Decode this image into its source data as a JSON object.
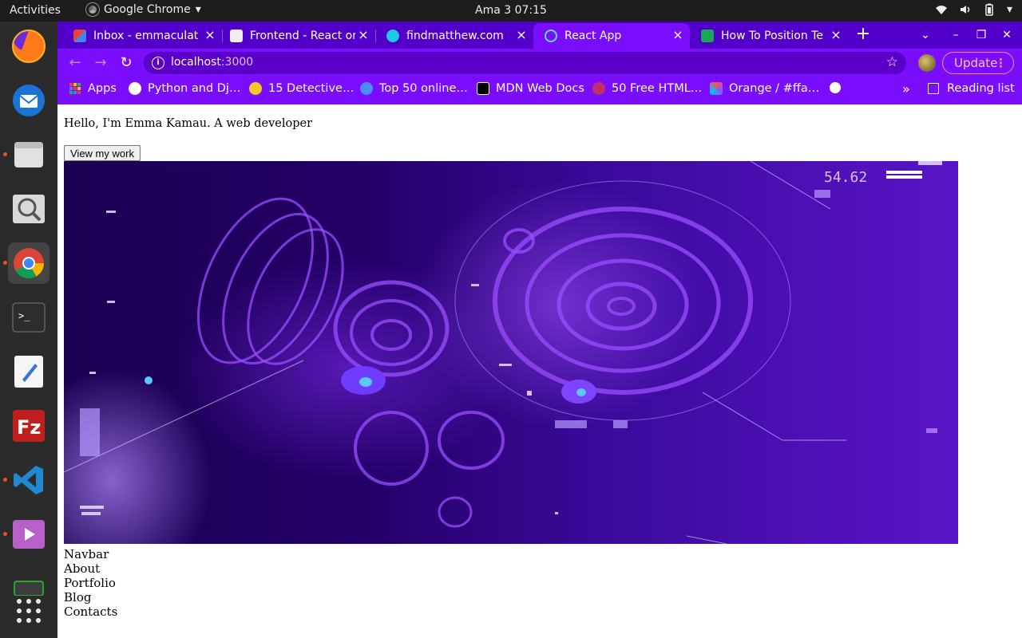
{
  "system_bar": {
    "activities": "Activities",
    "app_name": "Google Chrome",
    "clock": "Ama 3  07:15"
  },
  "dock": {
    "items": [
      {
        "name": "firefox"
      },
      {
        "name": "thunderbird"
      },
      {
        "name": "files"
      },
      {
        "name": "image-viewer"
      },
      {
        "name": "chrome"
      },
      {
        "name": "terminal"
      },
      {
        "name": "text-editor"
      },
      {
        "name": "filezilla"
      },
      {
        "name": "vscode"
      },
      {
        "name": "video-player"
      },
      {
        "name": "terminal-2"
      },
      {
        "name": "show-applications"
      }
    ]
  },
  "tabs": [
    {
      "title": "Inbox - emmaculate",
      "favicon_color": "#ea4335"
    },
    {
      "title": "Frontend - React or",
      "favicon_color": "#e8e8e8"
    },
    {
      "title": "findmatthew.com",
      "favicon_color": "#1ec8e6"
    },
    {
      "title": "React App",
      "favicon_color": "#61dafb"
    },
    {
      "title": "How To Position Te",
      "favicon_color": "#18a957"
    }
  ],
  "address_bar": {
    "host": "localhost",
    "port": ":3000"
  },
  "update_button": "Update",
  "bookmarks": [
    {
      "label": "Apps",
      "color": "#e94235"
    },
    {
      "label": "Python and Dj…",
      "color": "#ffffff"
    },
    {
      "label": "15 Detective…",
      "color": "#f3c623"
    },
    {
      "label": "Top 50 online…",
      "color": "#4c8bf5"
    },
    {
      "label": "MDN Web Docs",
      "color": "#000000"
    },
    {
      "label": "50 Free HTML…",
      "color": "#c0306a"
    },
    {
      "label": "Orange / #ffa…",
      "color": "#7b5cff"
    }
  ],
  "reading_list": "Reading list",
  "page": {
    "intro": "Hello, I'm Emma Kamau. A web developer",
    "button": "View my work",
    "nav_items": [
      "Navbar",
      "About",
      "Portfolio",
      "Blog",
      "Contacts"
    ]
  },
  "hero": {
    "readout": "54.62"
  }
}
